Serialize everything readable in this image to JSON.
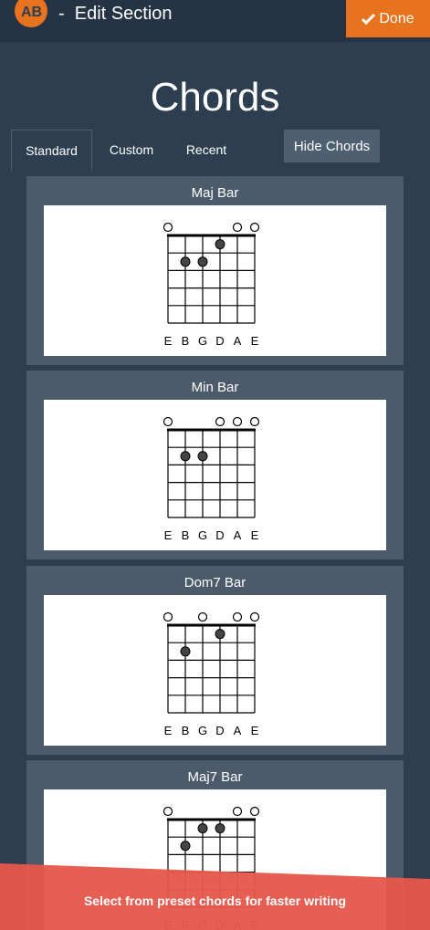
{
  "header": {
    "title": "Edit Section",
    "separator": "-",
    "logo_text": "AB",
    "done_label": "Done",
    "done_icon": "check-icon"
  },
  "page": {
    "heading": "Chords",
    "hide_label": "Hide Chords"
  },
  "tabs": [
    {
      "label": "Standard",
      "active": true
    },
    {
      "label": "Custom",
      "active": false
    },
    {
      "label": "Recent",
      "active": false
    }
  ],
  "string_labels": [
    "E",
    "B",
    "G",
    "D",
    "A",
    "E"
  ],
  "chords": [
    {
      "name": "Maj Bar",
      "open": [
        0,
        4,
        5
      ],
      "dots": [
        {
          "string": 3,
          "fret": 1
        },
        {
          "string": 1,
          "fret": 2
        },
        {
          "string": 2,
          "fret": 2
        }
      ]
    },
    {
      "name": "Min Bar",
      "open": [
        0,
        3,
        4,
        5
      ],
      "dots": [
        {
          "string": 1,
          "fret": 2
        },
        {
          "string": 2,
          "fret": 2
        }
      ]
    },
    {
      "name": "Dom7 Bar",
      "open": [
        0,
        2,
        4,
        5
      ],
      "dots": [
        {
          "string": 3,
          "fret": 1
        },
        {
          "string": 1,
          "fret": 2
        }
      ]
    },
    {
      "name": "Maj7 Bar",
      "open": [
        0,
        4,
        5
      ],
      "dots": [
        {
          "string": 2,
          "fret": 1
        },
        {
          "string": 3,
          "fret": 1
        },
        {
          "string": 1,
          "fret": 2
        }
      ]
    }
  ],
  "toast": {
    "message": "Select from preset chords for faster writing"
  },
  "colors": {
    "background": "#2d3e50",
    "accent": "#e8731e",
    "toast": "#e6574b",
    "card": "#4b5b6b"
  }
}
